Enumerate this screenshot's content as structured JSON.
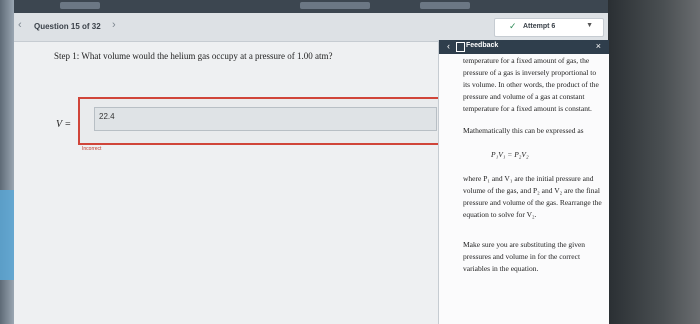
{
  "nav": {
    "question_label": "Question 15 of 32",
    "attempt_label": "Attempt 6"
  },
  "question": {
    "step_label": "Step 1:",
    "text": "What volume would the helium gas occupy at a pressure of 1.00 atm?",
    "variable": "V =",
    "answer_value": "22.4",
    "status": "Incorrect"
  },
  "feedback": {
    "title": "Feedback",
    "para1": "temperature for a fixed amount of gas, the pressure of a gas is inversely proportional to its volume. In other words, the product of the pressure and volume of a gas at constant temperature for a fixed amount is constant.",
    "para2": "Mathematically this can be expressed as",
    "equation": "P₁V₁ = P₂V₂",
    "para3": "where P₁ and V₁ are the initial pressure and volume of the gas, and P₂ and V₂ are the final pressure and volume of the gas. Rearrange the equation to solve for V₂.",
    "para4": "Make sure you are substituting the given pressures and volume in for the correct variables in the equation."
  }
}
